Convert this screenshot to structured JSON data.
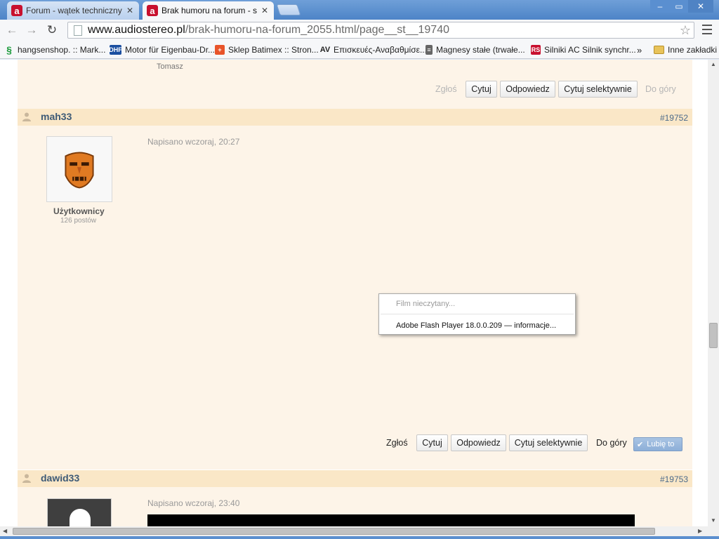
{
  "browser": {
    "tabs": [
      {
        "title": "Forum - wątek techniczny - s",
        "active": false
      },
      {
        "title": "Brak humoru na forum - stron",
        "active": true
      }
    ],
    "url_host": "www.audiostereo.pl",
    "url_path": "/brak-humoru-na-forum_2055.html/page__st__19740",
    "bookmarks": [
      "hangsenshop. :: Mark...",
      "Motor für Eigenbau-Dr...",
      "Sklep Batimex :: Stron...",
      "Επισκευές-Αναβαθμίσε...",
      "Magnesy stałe (trwałe...",
      "Silniki AC Silnik synchr..."
    ],
    "bookmarks_more": "»",
    "other_bookmarks": "Inne zakładki",
    "window_buttons": [
      "–",
      "▭",
      "✕"
    ],
    "colors": {
      "accent": "#4d84c7",
      "post_header": "#fae7c7",
      "post_bg": "#fdf4e8",
      "username": "#3d5a76"
    }
  },
  "prev_post": {
    "signature": "Tomasz",
    "actions": {
      "report": "Zgłoś",
      "quote": "Cytuj",
      "reply": "Odpowiedz",
      "quote_selective": "Cytuj selektywnie",
      "top": "Do góry"
    }
  },
  "post1": {
    "username": "mah33",
    "number": "#19752",
    "date": "Napisano wczoraj, 20:27",
    "group": "Użytkownicy",
    "posts": "126 postów",
    "actions": {
      "report": "Zgłoś",
      "quote": "Cytuj",
      "reply": "Odpowiedz",
      "quote_selective": "Cytuj selektywnie",
      "top": "Do góry",
      "like": "Lubię to"
    }
  },
  "context_menu": {
    "item1": "Film nieczytany...",
    "item2": "Adobe Flash Player 18.0.0.209 — informacje..."
  },
  "post2": {
    "username": "dawid33",
    "number": "#19753",
    "date": "Napisano wczoraj, 23:40"
  }
}
